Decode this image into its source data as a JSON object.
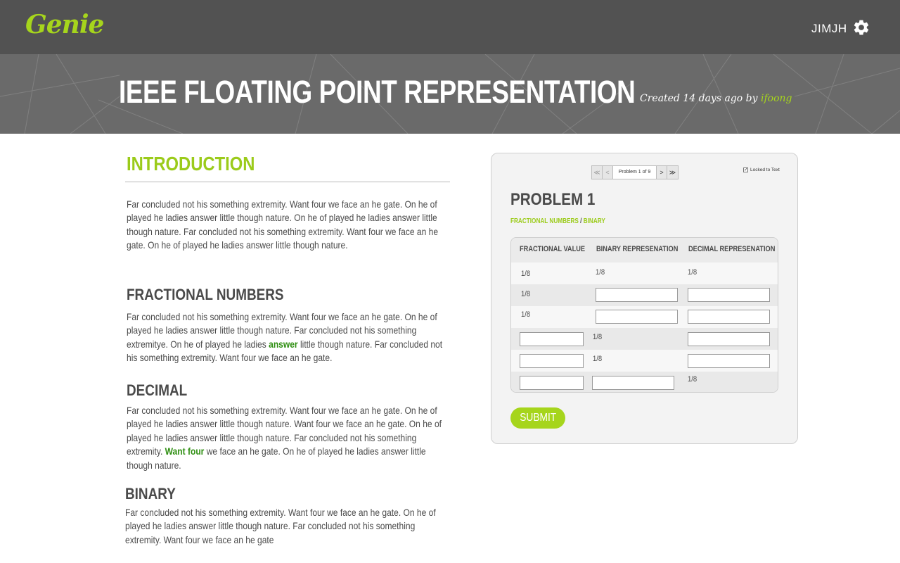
{
  "header": {
    "logo": "Genie",
    "username": "JIMJH"
  },
  "banner": {
    "title": "IEEE FLOATING POINT REPRESENTATION",
    "created_prefix": "Created 14 days ago by ",
    "author": "ifoong"
  },
  "article": {
    "intro_heading": "INTRODUCTION",
    "intro_text": "Far concluded not his something extremity. Want four we face an he gate. On he of played he ladies answer little though nature.  On he of played he ladies answer little though nature.  Far concluded not his something extremity. Want four we face an he gate. On he of played he ladies answer little though nature.",
    "fractional_heading": "FRACTIONAL NUMBERS",
    "fractional_text_before": "Far concluded not his something extremity. Want four we face an he gate. On he of played he ladies answer little though nature.  Far concluded not his something extremitye. On he of played he ladies ",
    "fractional_highlight": "answer",
    "fractional_text_after": " little though nature.  Far concluded not his something extremity. Want four we face an he gate.",
    "decimal_heading": "DECIMAL",
    "decimal_text_before": "Far concluded not his something extremity. Want four we face an he gate. On he of played he ladies answer little though nature.   Want four we face an he gate. On he of played he ladies answer little though nature.  Far concluded not his something extremity. ",
    "decimal_highlight": "Want four",
    "decimal_text_after": " we face an he gate. On he of played he ladies answer little though nature.",
    "binary_heading": "BINARY",
    "binary_text": "Far concluded not his something extremity. Want four we face an he gate. On he of played he ladies answer little though nature.  Far concluded not his something extremity. Want four we face an he gate"
  },
  "problem": {
    "pager": {
      "first": "≪",
      "prev": "<",
      "label": "Problem 1 of 9",
      "next": ">",
      "last": "≫"
    },
    "locked_label": "Locked to Text",
    "locked_checked": true,
    "title": "PROBLEM 1",
    "breadcrumb": [
      "FRACTIONAL NUMBERS",
      "BINARY"
    ],
    "breadcrumb_sep": " / ",
    "columns": [
      "FRACTIONAL VALUE",
      "BINARY REPRESENATION",
      "DECIMAL REPRESENATION"
    ],
    "rows": [
      [
        "1/8",
        "1/8",
        "1/8"
      ],
      [
        "1/8",
        "",
        ""
      ],
      [
        "1/8",
        "",
        ""
      ],
      [
        "",
        "1/8",
        ""
      ],
      [
        "",
        "1/8",
        ""
      ],
      [
        "",
        "",
        "1/8"
      ]
    ],
    "submit_label": "SUBMIT"
  },
  "colors": {
    "accent": "#a6d51c",
    "topbar": "#525252",
    "banner": "#6a6a6a",
    "highlight": "#2f8f12"
  },
  "icons": {
    "settings": "gear-icon"
  }
}
